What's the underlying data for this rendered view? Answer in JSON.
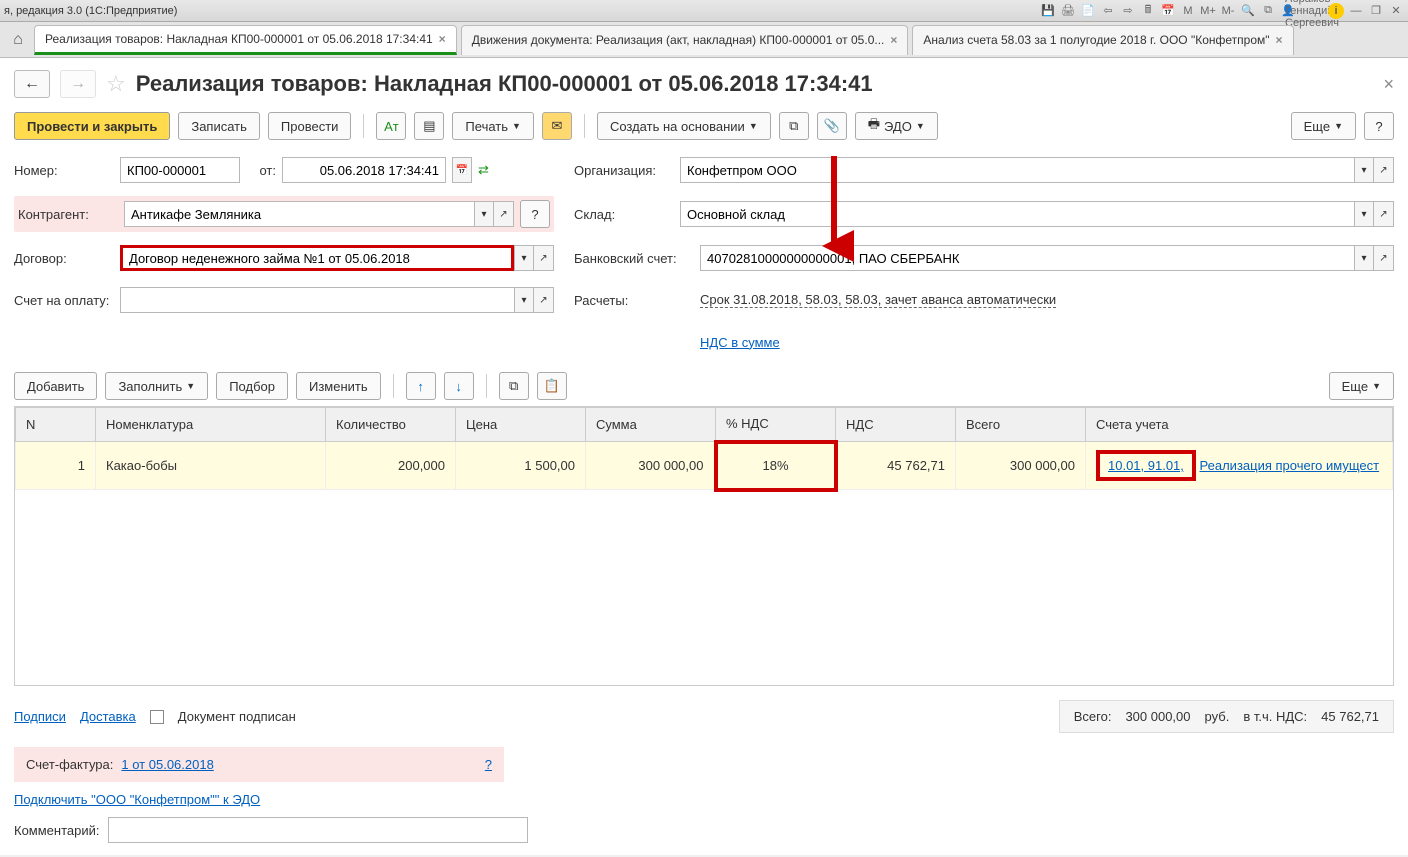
{
  "titlebar": {
    "title": "я, редакция 3.0  (1С:Предприятие)",
    "user": "Абрамов Геннадий Сергеевич"
  },
  "tabs": {
    "t1": "Реализация товаров: Накладная КП00-000001 от 05.06.2018 17:34:41",
    "t2": "Движения документа: Реализация (акт, накладная) КП00-000001 от 05.0...",
    "t3": "Анализ счета 58.03 за 1 полугодие 2018 г. ООО \"Конфетпром\""
  },
  "header": {
    "title": "Реализация товаров: Накладная КП00-000001 от 05.06.2018 17:34:41"
  },
  "toolbar": {
    "post_close": "Провести и закрыть",
    "save": "Записать",
    "post": "Провести",
    "print": "Печать",
    "create_based": "Создать на основании",
    "edo": "ЭДО",
    "more": "Еще"
  },
  "form": {
    "number_label": "Номер:",
    "number": "КП00-000001",
    "from_label": "от:",
    "date": "05.06.2018 17:34:41",
    "org_label": "Организация:",
    "org": "Конфетпром ООО",
    "counterparty_label": "Контрагент:",
    "counterparty": "Антикафе Земляника",
    "warehouse_label": "Склад:",
    "warehouse": "Основной склад",
    "contract_label": "Договор:",
    "contract": "Договор неденежного займа №1 от 05.06.2018",
    "bank_label": "Банковский счет:",
    "bank": "40702810000000000001, ПАО СБЕРБАНК",
    "pay_label": "Счет на оплату:",
    "pay": "",
    "calc_label": "Расчеты:",
    "calc_link": "Срок 31.08.2018, 58.03, 58.03, зачет аванса автоматически",
    "vat_link": "НДС в сумме"
  },
  "tbl_toolbar": {
    "add": "Добавить",
    "fill": "Заполнить",
    "select": "Подбор",
    "change": "Изменить",
    "more": "Еще"
  },
  "table": {
    "cols": {
      "n": "N",
      "nom": "Номенклатура",
      "qty": "Количество",
      "price": "Цена",
      "sum": "Сумма",
      "vatp": "% НДС",
      "vat": "НДС",
      "total": "Всего",
      "acc": "Счета учета"
    },
    "row": {
      "n": "1",
      "nom": "Какао-бобы",
      "qty": "200,000",
      "price": "1 500,00",
      "sum": "300 000,00",
      "vatp": "18%",
      "vat": "45 762,71",
      "total": "300 000,00",
      "acc": "10.01, 91.01,",
      "acc_tail": "Реализация прочего имущест"
    }
  },
  "footer": {
    "signatures": "Подписи",
    "delivery": "Доставка",
    "doc_signed": "Документ подписан",
    "total_label": "Всего:",
    "total": "300 000,00",
    "rub": "руб.",
    "vat_label": "в т.ч. НДС:",
    "vat": "45 762,71",
    "invoice_label": "Счет-фактура:",
    "invoice_link": "1 от 05.06.2018",
    "connect_edo": "Подключить \"ООО \"Конфетпром\"\" к ЭДО",
    "comment_label": "Комментарий:"
  }
}
